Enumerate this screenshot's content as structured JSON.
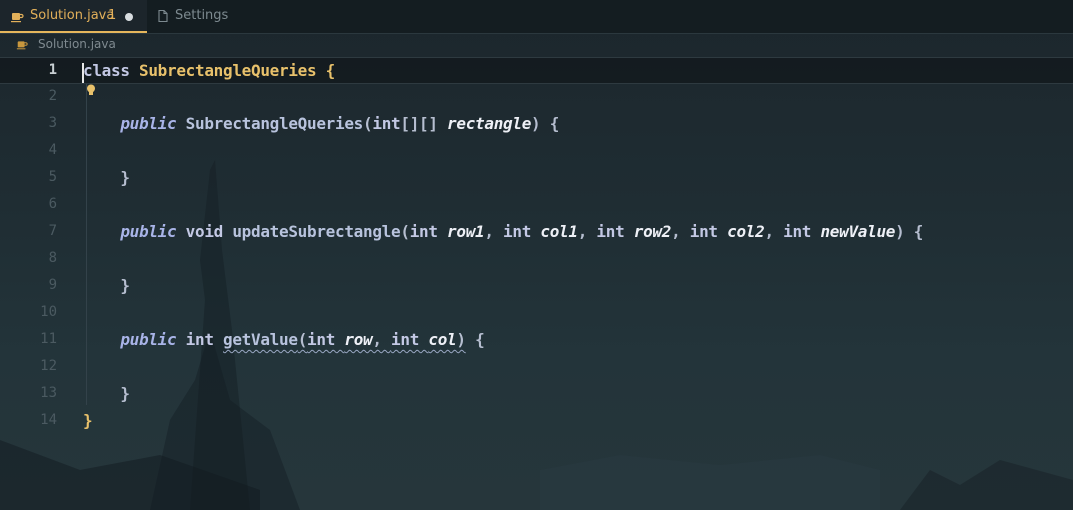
{
  "tabs": [
    {
      "label": "Solution.java",
      "badge": "1",
      "modified": true,
      "active": true
    },
    {
      "label": "Settings",
      "active": false
    }
  ],
  "breadcrumb": {
    "file": "Solution.java"
  },
  "editor": {
    "lines": [
      {
        "num": "1",
        "tokens": [
          {
            "t": "class ",
            "c": "kw"
          },
          {
            "t": "SubrectangleQueries",
            "c": "cls"
          },
          {
            "t": " {",
            "c": "brace"
          }
        ]
      },
      {
        "num": "2",
        "tokens": []
      },
      {
        "num": "3",
        "tokens": [
          {
            "t": "    ",
            "c": ""
          },
          {
            "t": "public",
            "c": "kwi"
          },
          {
            "t": " SubrectangleQueries",
            "c": "fn"
          },
          {
            "t": "(",
            "c": "punc"
          },
          {
            "t": "int",
            "c": "kw"
          },
          {
            "t": "[][] ",
            "c": "punc"
          },
          {
            "t": "rectangle",
            "c": "param"
          },
          {
            "t": ") {",
            "c": "punc"
          }
        ]
      },
      {
        "num": "4",
        "tokens": []
      },
      {
        "num": "5",
        "tokens": [
          {
            "t": "    }",
            "c": "punc"
          }
        ]
      },
      {
        "num": "6",
        "tokens": []
      },
      {
        "num": "7",
        "tokens": [
          {
            "t": "    ",
            "c": ""
          },
          {
            "t": "public",
            "c": "kwi"
          },
          {
            "t": " void ",
            "c": "kw"
          },
          {
            "t": "updateSubrectangle",
            "c": "fn"
          },
          {
            "t": "(",
            "c": "punc"
          },
          {
            "t": "int ",
            "c": "kw"
          },
          {
            "t": "row1",
            "c": "param"
          },
          {
            "t": ", ",
            "c": "punc"
          },
          {
            "t": "int ",
            "c": "kw"
          },
          {
            "t": "col1",
            "c": "param"
          },
          {
            "t": ", ",
            "c": "punc"
          },
          {
            "t": "int ",
            "c": "kw"
          },
          {
            "t": "row2",
            "c": "param"
          },
          {
            "t": ", ",
            "c": "punc"
          },
          {
            "t": "int ",
            "c": "kw"
          },
          {
            "t": "col2",
            "c": "param"
          },
          {
            "t": ", ",
            "c": "punc"
          },
          {
            "t": "int ",
            "c": "kw"
          },
          {
            "t": "newValue",
            "c": "param"
          },
          {
            "t": ") {",
            "c": "punc"
          }
        ]
      },
      {
        "num": "8",
        "tokens": []
      },
      {
        "num": "9",
        "tokens": [
          {
            "t": "    }",
            "c": "punc"
          }
        ]
      },
      {
        "num": "10",
        "tokens": []
      },
      {
        "num": "11",
        "tokens": [
          {
            "t": "    ",
            "c": ""
          },
          {
            "t": "public",
            "c": "kwi"
          },
          {
            "t": " int ",
            "c": "kw"
          },
          {
            "t": "getValue",
            "c": "fn squig"
          },
          {
            "t": "(",
            "c": "punc squig"
          },
          {
            "t": "int ",
            "c": "kw squig"
          },
          {
            "t": "row",
            "c": "param squig"
          },
          {
            "t": ", ",
            "c": "punc squig"
          },
          {
            "t": "int ",
            "c": "kw squig"
          },
          {
            "t": "col",
            "c": "param squig"
          },
          {
            "t": ")",
            "c": "punc squig"
          },
          {
            "t": " {",
            "c": "punc"
          }
        ]
      },
      {
        "num": "12",
        "tokens": []
      },
      {
        "num": "13",
        "tokens": [
          {
            "t": "    }",
            "c": "punc"
          }
        ]
      },
      {
        "num": "14",
        "tokens": [
          {
            "t": "}",
            "c": "brace"
          }
        ]
      }
    ]
  },
  "colors": {
    "accent": "#e2b05a",
    "class_name": "#e8c16b",
    "keyword": "#a9b4e8"
  }
}
